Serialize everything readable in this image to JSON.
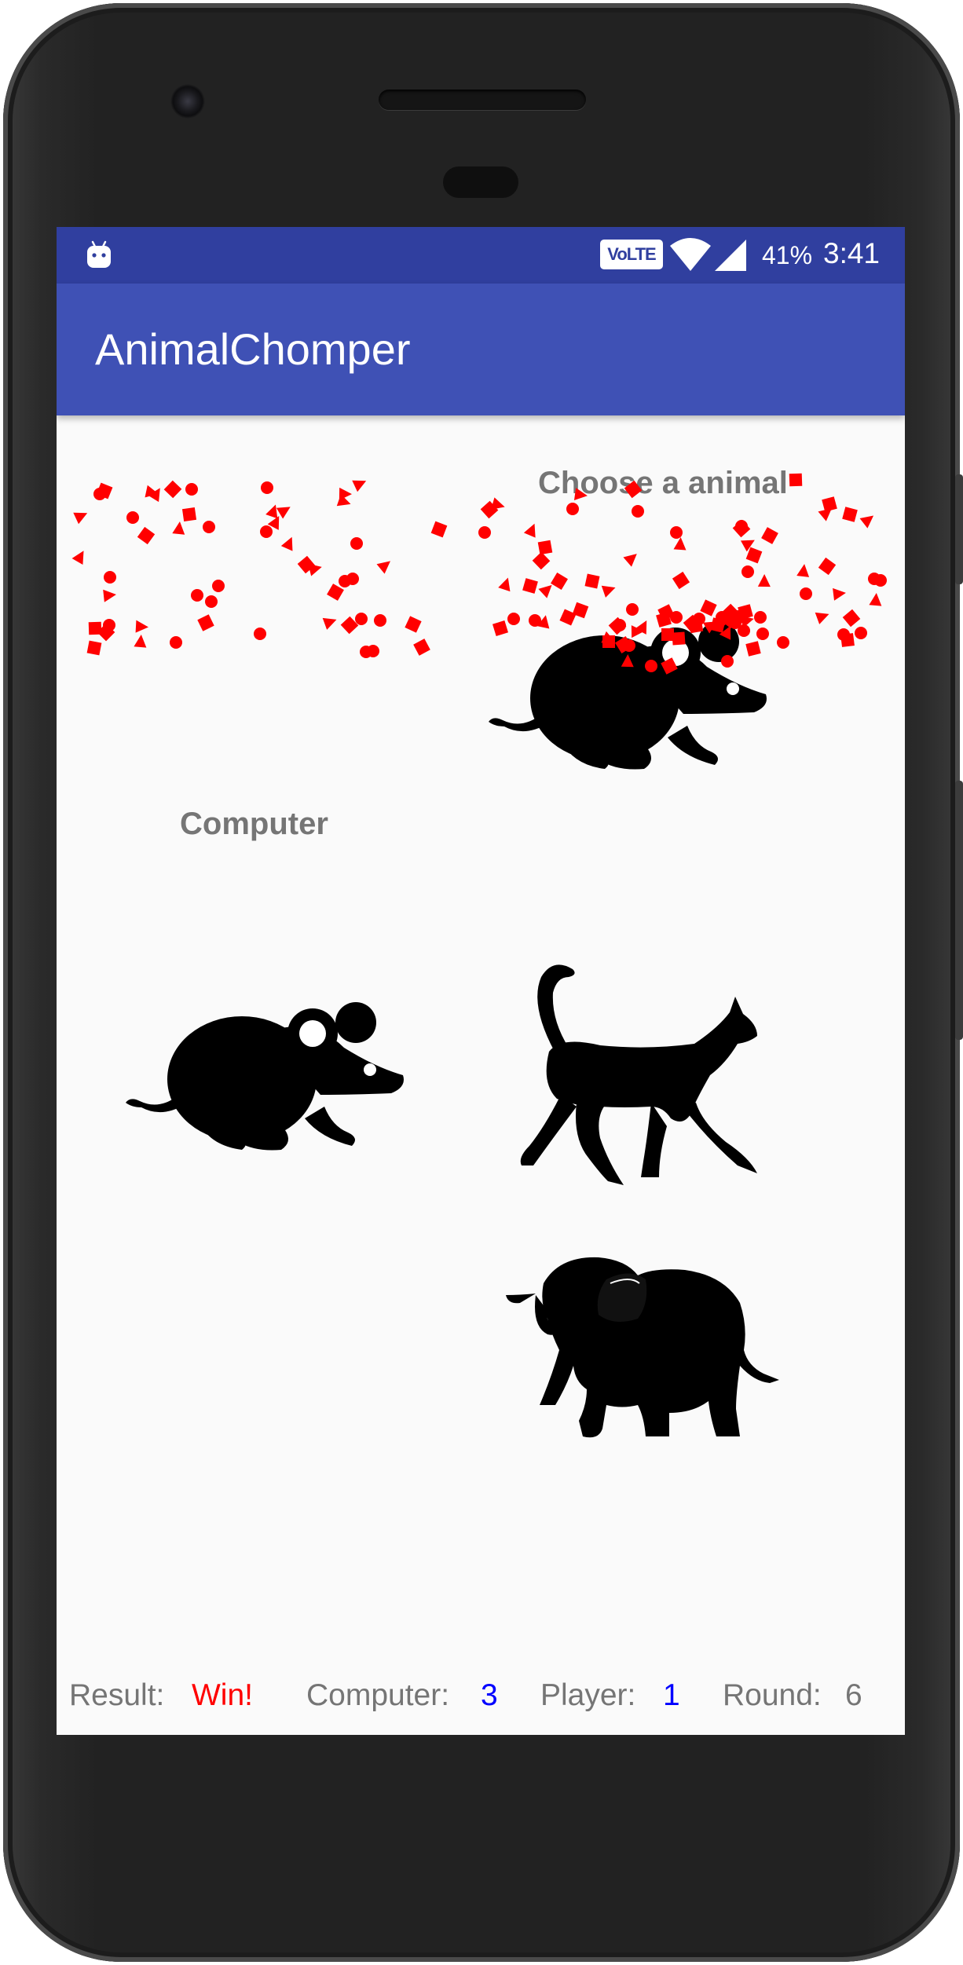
{
  "status_bar": {
    "volte": "VoLTE",
    "battery": "41%",
    "time": "3:41",
    "icons": [
      "android-debug-icon",
      "volte-icon",
      "wifi-icon",
      "cell-signal-icon"
    ]
  },
  "app_bar": {
    "title": "AnimalChomper"
  },
  "game": {
    "choose_label": "Choose a animal",
    "computer_label": "Computer",
    "player_choice": "mouse-icon",
    "computer_choice": "mouse-icon",
    "options": [
      "cat-icon",
      "elephant-icon"
    ],
    "confetti_color": "#ff0000"
  },
  "score": {
    "result_label": "Result:",
    "result_value": "Win!",
    "computer_label": "Computer:",
    "computer_value": "3",
    "player_label": "Player:",
    "player_value": "1",
    "round_label": "Round:",
    "round_value": "6"
  },
  "colors": {
    "status_bar": "#303f9f",
    "app_bar": "#3f51b5",
    "background": "#fafafa",
    "label_gray": "#757575",
    "result_red": "#ff0000",
    "score_blue": "#0000ff"
  }
}
